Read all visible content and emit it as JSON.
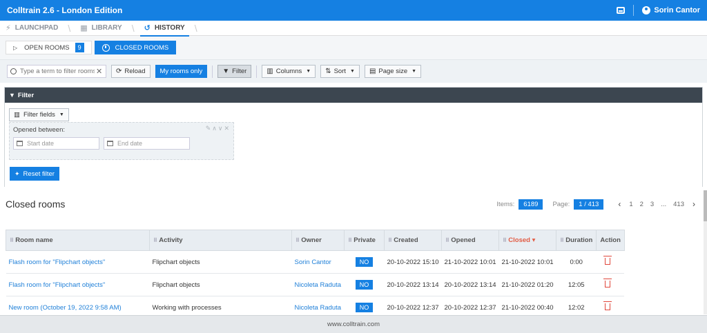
{
  "app": {
    "title": "Colltrain 2.6 - London Edition",
    "user": "Sorin Cantor"
  },
  "nav": {
    "tabs": [
      "LAUNCHPAD",
      "LIBRARY",
      "HISTORY"
    ]
  },
  "subtabs": {
    "open_label": "OPEN ROOMS",
    "open_count": "9",
    "closed_label": "CLOSED ROOMS"
  },
  "toolbar": {
    "search_placeholder": "Type a term to filter rooms",
    "reload": "Reload",
    "my_rooms": "My rooms only",
    "filter": "Filter",
    "columns": "Columns",
    "sort": "Sort",
    "page_size": "Page size"
  },
  "filter": {
    "title": "Filter",
    "fields_button": "Filter fields",
    "opened_between": "Opened between:",
    "start_placeholder": "Start date",
    "end_placeholder": "End date",
    "reset": "Reset filter"
  },
  "results": {
    "title": "Closed rooms",
    "items_label": "Items:",
    "items": "6189",
    "page_label": "Page:",
    "page": "1 / 413",
    "pages": [
      "1",
      "2",
      "3",
      "...",
      "413"
    ]
  },
  "table": {
    "headers": {
      "room": "Room name",
      "activity": "Activity",
      "owner": "Owner",
      "private": "Private",
      "created": "Created",
      "opened": "Opened",
      "closed": "Closed",
      "duration": "Duration",
      "action": "Action"
    },
    "rows": [
      {
        "room": "Flash room for \"Flipchart objects\"",
        "activity": "Flipchart objects",
        "owner": "Sorin Cantor",
        "private": "NO",
        "created": "20-10-2022 15:10",
        "opened": "21-10-2022 10:01",
        "closed": "21-10-2022 10:01",
        "duration": "0:00"
      },
      {
        "room": "Flash room for \"Flipchart objects\"",
        "activity": "Flipchart objects",
        "owner": "Nicoleta Raduta",
        "private": "NO",
        "created": "20-10-2022 13:14",
        "opened": "20-10-2022 13:14",
        "closed": "21-10-2022 01:20",
        "duration": "12:05"
      },
      {
        "room": "New room (October 19, 2022 9:58 AM)",
        "activity": "Working with processes",
        "owner": "Nicoleta Raduta",
        "private": "NO",
        "created": "20-10-2022 12:37",
        "opened": "20-10-2022 12:37",
        "closed": "21-10-2022 00:40",
        "duration": "12:02"
      }
    ]
  },
  "footer": {
    "text": "www.colltrain.com"
  },
  "colors": {
    "accent": "#1580e2",
    "header_dark": "#3c4650",
    "danger": "#e0453a",
    "sorted": "#e25b43"
  }
}
